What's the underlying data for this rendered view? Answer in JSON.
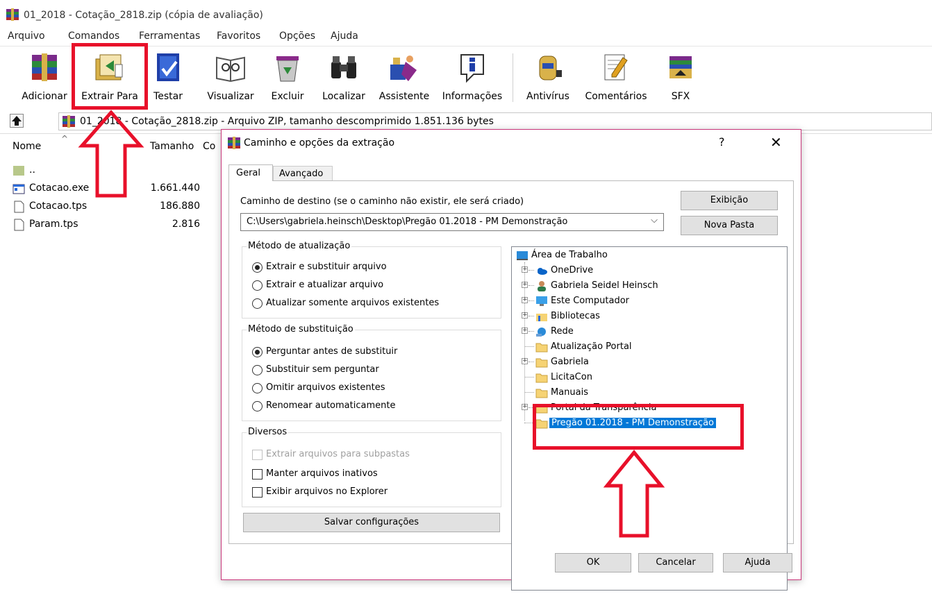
{
  "window": {
    "title": "01_2018 - Cotação_2818.zip (cópia de avaliação)"
  },
  "menu": [
    "Arquivo",
    "Comandos",
    "Ferramentas",
    "Favoritos",
    "Opções",
    "Ajuda"
  ],
  "toolbar": [
    {
      "label": "Adicionar",
      "icon": "books-add-icon"
    },
    {
      "label": "Extrair Para",
      "icon": "extract-folder-icon"
    },
    {
      "label": "Testar",
      "icon": "test-check-icon"
    },
    {
      "label": "Visualizar",
      "icon": "view-book-icon"
    },
    {
      "label": "Excluir",
      "icon": "delete-bin-icon"
    },
    {
      "label": "Localizar",
      "icon": "binoculars-icon"
    },
    {
      "label": "Assistente",
      "icon": "wizard-icon"
    },
    {
      "label": "Informações",
      "icon": "info-icon"
    },
    {
      "label": "Antivírus",
      "icon": "antivirus-icon"
    },
    {
      "label": "Comentários",
      "icon": "comment-pen-icon"
    },
    {
      "label": "SFX",
      "icon": "sfx-icon"
    }
  ],
  "address": {
    "path": "01_2018 - Cotação_2818.zip - Arquivo ZIP, tamanho descomprimido 1.851.136 bytes"
  },
  "file_list": {
    "columns": {
      "name": "Nome",
      "size": "Tamanho",
      "compressed": "Co"
    },
    "rows": [
      {
        "name": "..",
        "size": "",
        "icon": "folder-up-icon"
      },
      {
        "name": "Cotacao.exe",
        "size": "1.661.440",
        "icon": "exe-file-icon"
      },
      {
        "name": "Cotacao.tps",
        "size": "186.880",
        "icon": "file-icon"
      },
      {
        "name": "Param.tps",
        "size": "2.816",
        "icon": "file-icon"
      }
    ]
  },
  "dialog": {
    "title": "Caminho e opções da extração",
    "help": "?",
    "close": "✕",
    "tabs": [
      "Geral",
      "Avançado"
    ],
    "dest_label": "Caminho de destino (se o caminho não existir, ele será criado)",
    "dest_value": "C:\\Users\\gabriela.heinsch\\Desktop\\Pregão 01.2018 - PM Demonstração",
    "btn_exibicao": "Exibição",
    "btn_nova_pasta": "Nova Pasta",
    "update_group": {
      "label": "Método de atualização",
      "options": [
        "Extrair e substituir arquivo",
        "Extrair e atualizar arquivo",
        "Atualizar somente arquivos existentes"
      ],
      "selected": 0
    },
    "overwrite_group": {
      "label": "Método de substituição",
      "options": [
        "Perguntar antes de substituir",
        "Substituir sem perguntar",
        "Omitir arquivos existentes",
        "Renomear automaticamente"
      ],
      "selected": 0
    },
    "misc_group": {
      "label": "Diversos",
      "options": [
        {
          "label": "Extrair arquivos para subpastas",
          "checked": false,
          "disabled": true
        },
        {
          "label": "Manter arquivos inativos",
          "checked": false,
          "disabled": false
        },
        {
          "label": "Exibir arquivos no Explorer",
          "checked": false,
          "disabled": false
        }
      ]
    },
    "btn_save": "Salvar configurações",
    "tree": [
      {
        "label": "Área de Trabalho",
        "icon": "desktop-icon",
        "level": 0,
        "expander": false
      },
      {
        "label": "OneDrive",
        "icon": "onedrive-cloud-icon",
        "level": 1,
        "expander": true
      },
      {
        "label": "Gabriela Seidel Heinsch",
        "icon": "user-icon",
        "level": 1,
        "expander": true
      },
      {
        "label": "Este Computador",
        "icon": "computer-icon",
        "level": 1,
        "expander": true
      },
      {
        "label": "Bibliotecas",
        "icon": "libraries-icon",
        "level": 1,
        "expander": true
      },
      {
        "label": "Rede",
        "icon": "network-icon",
        "level": 1,
        "expander": true
      },
      {
        "label": "Atualização Portal",
        "icon": "folder-icon",
        "level": 1,
        "expander": false
      },
      {
        "label": "Gabriela",
        "icon": "folder-icon",
        "level": 1,
        "expander": true
      },
      {
        "label": "LicitaCon",
        "icon": "folder-icon",
        "level": 1,
        "expander": false
      },
      {
        "label": "Manuais",
        "icon": "folder-icon",
        "level": 1,
        "expander": false
      },
      {
        "label": "Portal da Transparência",
        "icon": "folder-icon",
        "level": 1,
        "expander": true
      },
      {
        "label": "Pregão 01.2018 - PM Demonstração",
        "icon": "folder-icon",
        "level": 1,
        "expander": false,
        "selected": true
      }
    ],
    "btn_ok": "OK",
    "btn_cancel": "Cancelar",
    "btn_help": "Ajuda"
  },
  "colors": {
    "annotation_red": "#e8102a",
    "selection_blue": "#0078d7",
    "folder_yellow": "#f6d374"
  }
}
